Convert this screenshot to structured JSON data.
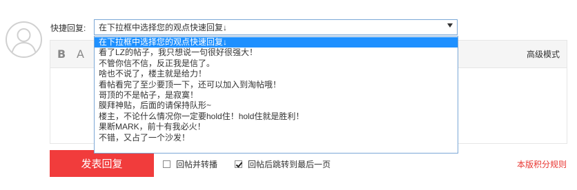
{
  "quick_reply": {
    "label": "快捷回复:",
    "selected_value": "在下拉框中选择您的观点快速回复↓",
    "options": [
      "在下拉框中选择您的观点快速回复↓",
      "看了LZ的帖子，我只想说一句很好很强大！",
      "不管你信不信，反正我是信了。",
      "啥也不说了，楼主就是给力！",
      "看帖看完了至少要顶一下，还可以加入到淘帖哦！",
      "哥顶的不是帖子，是寂寞！",
      "膜拜神贴，后面的请保持队形~",
      "楼主，不论什么情况你一定要hold住！hold住就是胜利！",
      "果断MARK，前十有我必火！",
      "不错，又占了一个沙发！"
    ],
    "selected_index": 0
  },
  "editor": {
    "bold_icon": "B",
    "font_icon": "A",
    "advanced_mode_label": "高级模式"
  },
  "actions": {
    "submit_label": "发表回复",
    "forward_label": "回帖并转播",
    "forward_checked": false,
    "jump_label": "回帖后跳转到最后一页",
    "jump_checked": true,
    "rules_label": "本版积分规则"
  },
  "colors": {
    "submit_bg": "#f13c3c",
    "selected_option_bg": "#1e90ff",
    "rules_link": "#e8342f",
    "select_border": "#7aa7d6"
  },
  "icons": {
    "avatar": "user-avatar-icon",
    "dropdown_arrow": "caret-down-icon",
    "checkbox": "checkbox-icon"
  }
}
